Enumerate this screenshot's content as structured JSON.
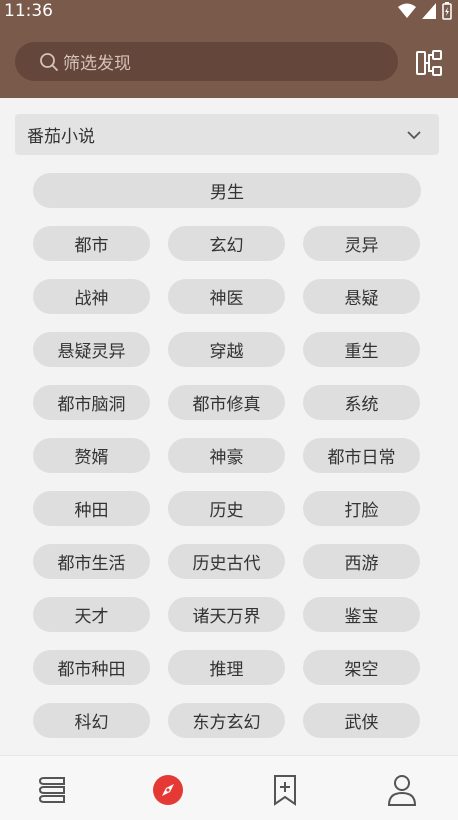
{
  "status": {
    "time": "11:36"
  },
  "search": {
    "placeholder": "筛选发现"
  },
  "source": {
    "selected": "番茄小说"
  },
  "group": {
    "title": "男生"
  },
  "tags": [
    "都市",
    "玄幻",
    "灵异",
    "战神",
    "神医",
    "悬疑",
    "悬疑灵异",
    "穿越",
    "重生",
    "都市脑洞",
    "都市修真",
    "系统",
    "赘婿",
    "神豪",
    "都市日常",
    "种田",
    "历史",
    "打脸",
    "都市生活",
    "历史古代",
    "西游",
    "天才",
    "诸天万界",
    "鉴宝",
    "都市种田",
    "推理",
    "架空",
    "科幻",
    "东方玄幻",
    "武侠"
  ],
  "colors": {
    "appbar": "#7a5a4b",
    "active_nav": "#e53935",
    "tag_bg": "#dedede"
  },
  "nav": {
    "items": [
      "bookshelf-icon",
      "explore-icon",
      "bookmark-add-icon",
      "profile-icon"
    ],
    "active": "explore-icon"
  }
}
